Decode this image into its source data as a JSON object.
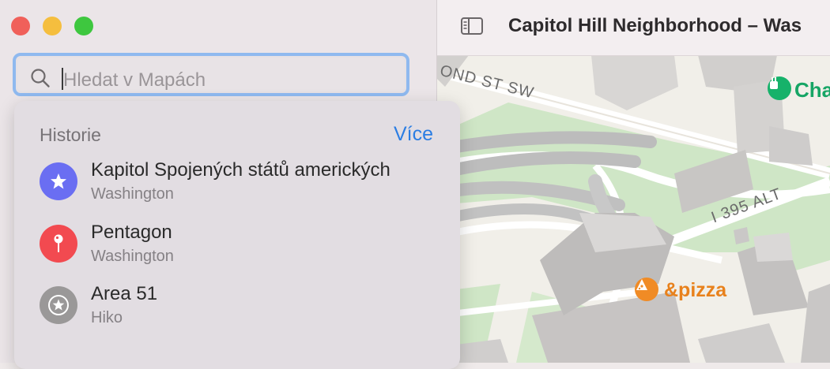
{
  "window": {
    "title": "Capitol Hill Neighborhood – Was",
    "traffic_colors": {
      "close": "#f0605a",
      "minimize": "#f5be3e",
      "zoom": "#3ec73f"
    }
  },
  "search": {
    "placeholder": "Hledat v Mapách"
  },
  "dropdown": {
    "section_title": "Historie",
    "more_label": "Více",
    "items": [
      {
        "title": "Kapitol Spojených států amerických",
        "subtitle": "Washington",
        "icon": "star-icon",
        "color": "#6a6ef2"
      },
      {
        "title": "Pentagon",
        "subtitle": "Washington",
        "icon": "pin-icon",
        "color": "#f24a50"
      },
      {
        "title": "Area 51",
        "subtitle": "Hiko",
        "icon": "star-circle-icon",
        "color": "#9a9898"
      }
    ]
  },
  "map": {
    "streets": [
      "OND ST SW",
      "I 395 ALT"
    ],
    "pois": [
      {
        "name": "&pizza",
        "icon": "pizza-icon",
        "color": "#f08b25"
      },
      {
        "name": "Cha",
        "icon": "ev-charger-icon",
        "color": "#16b26a"
      }
    ]
  }
}
